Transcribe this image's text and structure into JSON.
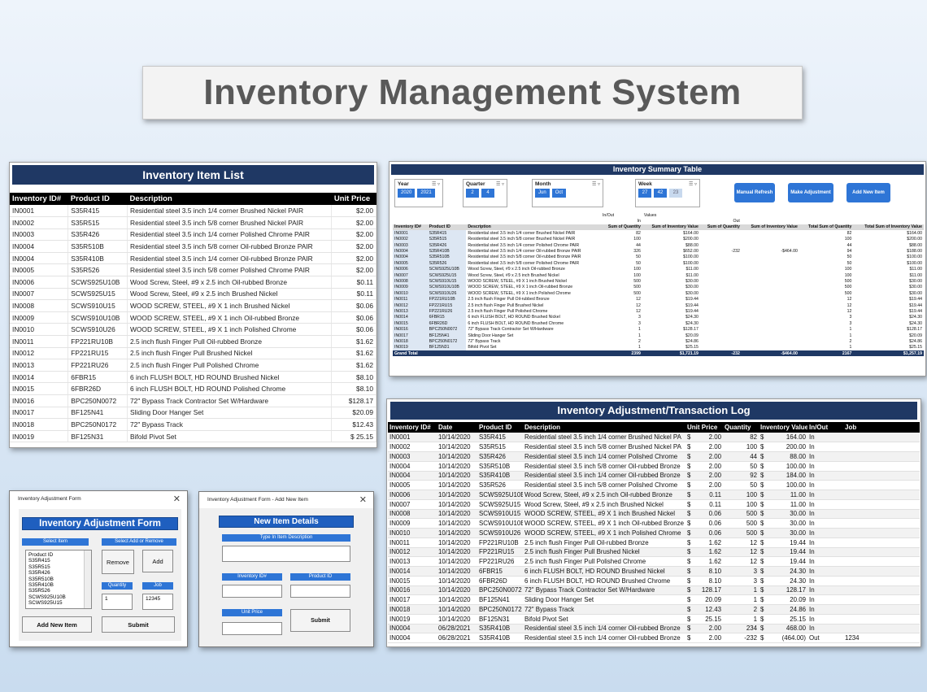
{
  "title": "Inventory Management System",
  "item_list": {
    "title": "Inventory Item List",
    "columns": [
      "Inventory ID#",
      "Product ID",
      "Description",
      "Unit Price"
    ],
    "rows": [
      [
        "IN0001",
        "S35R415",
        "Residential steel 3.5 inch 1/4 corner Brushed Nickel PAIR",
        "$2.00"
      ],
      [
        "IN0002",
        "S35R515",
        "Residential steel 3.5 inch 5/8 corner Brushed Nickel PAIR",
        "$2.00"
      ],
      [
        "IN0003",
        "S35R426",
        "Residential steel 3.5 inch 1/4 corner Polished Chrome PAIR",
        "$2.00"
      ],
      [
        "IN0004",
        "S35R510B",
        "Residential steel 3.5 inch 5/8 corner Oil-rubbed Bronze PAIR",
        "$2.00"
      ],
      [
        "IN0004",
        "S35R410B",
        "Residential steel 3.5 inch 1/4 corner Oil-rubbed Bronze PAIR",
        "$2.00"
      ],
      [
        "IN0005",
        "S35R526",
        "Residential steel 3.5 inch 5/8 corner Polished Chrome PAIR",
        "$2.00"
      ],
      [
        "IN0006",
        "SCWS925U10B",
        "Wood Screw, Steel, #9 x 2.5 inch Oil-rubbed Bronze",
        "$0.11"
      ],
      [
        "IN0007",
        "SCWS925U15",
        "Wood Screw, Steel, #9 x 2.5 inch Brushed Nickel",
        "$0.11"
      ],
      [
        "IN0008",
        "SCWS910U15",
        "WOOD SCREW, STEEL, #9 X 1 inch  Brushed Nickel",
        "$0.06"
      ],
      [
        "IN0009",
        "SCWS910U10B",
        "WOOD SCREW, STEEL, #9 X 1 inch  Oil-rubbed Bronze",
        "$0.06"
      ],
      [
        "IN0010",
        "SCWS910U26",
        "WOOD SCREW, STEEL, #9 X 1 inch  Polished Chrome",
        "$0.06"
      ],
      [
        "IN0011",
        "FP221RU10B",
        "2.5 inch flush Finger Pull  Oil-rubbed Bronze",
        "$1.62"
      ],
      [
        "IN0012",
        "FP221RU15",
        "2.5 inch flush Finger Pull  Brushed Nickel",
        "$1.62"
      ],
      [
        "IN0013",
        "FP221RU26",
        "2.5 inch flush Finger Pull  Polished Chrome",
        "$1.62"
      ],
      [
        "IN0014",
        "6FBR15",
        "6 inch FLUSH BOLT, HD ROUND Brushed Nickel",
        "$8.10"
      ],
      [
        "IN0015",
        "6FBR26D",
        "6 inch FLUSH BOLT, HD ROUND Polished Chrome",
        "$8.10"
      ],
      [
        "IN0016",
        "BPC250N0072",
        "72\" Bypass Track Contractor Set W/Hardware",
        "$128.17"
      ],
      [
        "IN0017",
        "BF125N41",
        "Sliding Door Hanger Set",
        "$20.09"
      ],
      [
        "IN0018",
        "BPC250N0172",
        "72\" Bypass Track",
        "$12.43"
      ],
      [
        "IN0019",
        "BF125N31",
        "Bifold Pivot Set",
        "$    25.15"
      ]
    ]
  },
  "summary": {
    "title": "Inventory Summary Table",
    "slicers": [
      {
        "label": "Year",
        "chips": [
          "2020",
          "2021"
        ]
      },
      {
        "label": "Quarter",
        "chips": [
          "2",
          "4"
        ]
      },
      {
        "label": "Month",
        "chips": [
          "Jun",
          "Oct"
        ]
      },
      {
        "label": "Week",
        "chips": [
          "27",
          "42",
          "23"
        ]
      }
    ],
    "buttons": [
      "Manual Refresh",
      "Make Adjustment",
      "Add New Item"
    ],
    "values_label": "Values",
    "inout_label": "In/Out",
    "in_label": "In",
    "out_label": "Out",
    "headers": [
      "Inventory ID#",
      "Product ID",
      "Description",
      "Sum of Quantity",
      "Sum of Inventory Value",
      "Sum of Quantity",
      "Sum of Inventory Value",
      "Total Sum of Quantity",
      "Total Sum of Inventory Value"
    ],
    "rows": [
      [
        "IN0001",
        "S35R415",
        "Residential steel 3.5 inch 1/4 corner Brushed Nickel PAIR",
        "82",
        "$164.00",
        "",
        "",
        "82",
        "$164.00"
      ],
      [
        "IN0002",
        "S35R515",
        "Residential steel 3.5 inch 5/8 corner Brushed Nickel PAIR",
        "100",
        "$200.00",
        "",
        "",
        "100",
        "$200.00"
      ],
      [
        "IN0003",
        "S35R426",
        "Residential steel 3.5 inch 1/4 corner Polished Chrome PAIR",
        "44",
        "$88.00",
        "",
        "",
        "44",
        "$88.00"
      ],
      [
        "IN0004",
        "S35R410B",
        "Residential steel 3.5 inch 1/4 corner Oil-rubbed Bronze PAIR",
        "326",
        "$652.00",
        "-232",
        "-$464.00",
        "94",
        "$188.00"
      ],
      [
        "IN0004",
        "S35R510B",
        "Residential steel 3.5 inch 5/8 corner Oil-rubbed Bronze PAIR",
        "50",
        "$100.00",
        "",
        "",
        "50",
        "$100.00"
      ],
      [
        "IN0005",
        "S35R526",
        "Residential steel 3.5 inch 5/8 corner Polished Chrome PAIR",
        "50",
        "$100.00",
        "",
        "",
        "50",
        "$100.00"
      ],
      [
        "IN0006",
        "SCWS925U10B",
        "Wood Screw, Steel, #9 x 2.5 inch Oil-rubbed Bronze",
        "100",
        "$11.00",
        "",
        "",
        "100",
        "$11.00"
      ],
      [
        "IN0007",
        "SCWS925U15",
        "Wood Screw, Steel, #9 x 2.5 inch Brushed Nickel",
        "100",
        "$11.00",
        "",
        "",
        "100",
        "$11.00"
      ],
      [
        "IN0008",
        "SCWS910U15",
        "WOOD SCREW, STEEL, #9 X 1 inch  Brushed Nickel",
        "500",
        "$30.00",
        "",
        "",
        "500",
        "$30.00"
      ],
      [
        "IN0009",
        "SCWS910U10B",
        "WOOD SCREW, STEEL, #9 X 1 inch  Oil-rubbed Bronze",
        "500",
        "$30.00",
        "",
        "",
        "500",
        "$30.00"
      ],
      [
        "IN0010",
        "SCWS910U26",
        "WOOD SCREW, STEEL, #9 X 1 inch  Polished Chrome",
        "500",
        "$30.00",
        "",
        "",
        "500",
        "$30.00"
      ],
      [
        "IN0011",
        "FP221RU10B",
        "2.5 inch flush Finger Pull  Oil-rubbed Bronze",
        "12",
        "$19.44",
        "",
        "",
        "12",
        "$19.44"
      ],
      [
        "IN0012",
        "FP221RU15",
        "2.5 inch flush Finger Pull  Brushed Nickel",
        "12",
        "$19.44",
        "",
        "",
        "12",
        "$19.44"
      ],
      [
        "IN0013",
        "FP221RU26",
        "2.5 inch flush Finger Pull  Polished Chrome",
        "12",
        "$19.44",
        "",
        "",
        "12",
        "$19.44"
      ],
      [
        "IN0014",
        "6FBR15",
        "6 inch FLUSH BOLT, HD ROUND Brushed Nickel",
        "3",
        "$24.30",
        "",
        "",
        "3",
        "$24.30"
      ],
      [
        "IN0015",
        "6FBR26D",
        "6 inch FLUSH BOLT, HD ROUND Brushed Chrome",
        "3",
        "$24.30",
        "",
        "",
        "3",
        "$24.30"
      ],
      [
        "IN0016",
        "BPC250N0072",
        "72\" Bypass Track Contractor Set W/Hardware",
        "1",
        "$128.17",
        "",
        "",
        "1",
        "$128.17"
      ],
      [
        "IN0017",
        "BF125N41",
        "Sliding Door Hanger Set",
        "1",
        "$20.09",
        "",
        "",
        "1",
        "$20.09"
      ],
      [
        "IN0018",
        "BPC250N0172",
        "72\" Bypass Track",
        "2",
        "$24.86",
        "",
        "",
        "2",
        "$24.86"
      ],
      [
        "IN0019",
        "BF125N31",
        "Bifold Pivot Set",
        "1",
        "$25.15",
        "",
        "",
        "1",
        "$25.15"
      ]
    ],
    "grand_total": [
      "Grand Total",
      "",
      "",
      "2399",
      "$1,721.19",
      "-232",
      "-$464.00",
      "2167",
      "$1,257.19"
    ]
  },
  "txlog": {
    "title": "Inventory Adjustment/Transaction Log",
    "columns": [
      "Inventory ID#",
      "Date",
      "Product ID",
      "Description",
      "Unit Price",
      "Quantity",
      "Inventory Value",
      "In/Out",
      "Job"
    ],
    "rows": [
      [
        "IN0001",
        "10/14/2020",
        "S35R415",
        "Residential steel 3.5 inch 1/4 corner Brushed Nickel PA",
        "$",
        "2.00",
        "82",
        "$",
        "164.00",
        "In",
        ""
      ],
      [
        "IN0002",
        "10/14/2020",
        "S35R515",
        "Residential steel 3.5 inch 5/8 corner Brushed Nickel PA",
        "$",
        "2.00",
        "100",
        "$",
        "200.00",
        "In",
        ""
      ],
      [
        "IN0003",
        "10/14/2020",
        "S35R426",
        "Residential steel 3.5 inch 1/4 corner Polished Chrome",
        "$",
        "2.00",
        "44",
        "$",
        "88.00",
        "In",
        ""
      ],
      [
        "IN0004",
        "10/14/2020",
        "S35R510B",
        "Residential steel 3.5 inch 5/8 corner Oil-rubbed Bronze",
        "$",
        "2.00",
        "50",
        "$",
        "100.00",
        "In",
        ""
      ],
      [
        "IN0004",
        "10/14/2020",
        "S35R410B",
        "Residential steel 3.5 inch 1/4 corner Oil-rubbed Bronze",
        "$",
        "2.00",
        "92",
        "$",
        "184.00",
        "In",
        ""
      ],
      [
        "IN0005",
        "10/14/2020",
        "S35R526",
        "Residential steel 3.5 inch 5/8 corner Polished Chrome",
        "$",
        "2.00",
        "50",
        "$",
        "100.00",
        "In",
        ""
      ],
      [
        "IN0006",
        "10/14/2020",
        "SCWS925U10B",
        "Wood Screw, Steel, #9 x 2.5 inch Oil-rubbed Bronze",
        "$",
        "0.11",
        "100",
        "$",
        "11.00",
        "In",
        ""
      ],
      [
        "IN0007",
        "10/14/2020",
        "SCWS925U15",
        "Wood Screw, Steel, #9 x 2.5 inch Brushed Nickel",
        "$",
        "0.11",
        "100",
        "$",
        "11.00",
        "In",
        ""
      ],
      [
        "IN0008",
        "10/14/2020",
        "SCWS910U15",
        "WOOD SCREW, STEEL, #9 X 1 inch  Brushed Nickel",
        "$",
        "0.06",
        "500",
        "$",
        "30.00",
        "In",
        ""
      ],
      [
        "IN0009",
        "10/14/2020",
        "SCWS910U10B",
        "WOOD SCREW, STEEL, #9 X 1 inch  Oil-rubbed Bronze",
        "$",
        "0.06",
        "500",
        "$",
        "30.00",
        "In",
        ""
      ],
      [
        "IN0010",
        "10/14/2020",
        "SCWS910U26",
        "WOOD SCREW, STEEL, #9 X 1 inch  Polished Chrome",
        "$",
        "0.06",
        "500",
        "$",
        "30.00",
        "In",
        ""
      ],
      [
        "IN0011",
        "10/14/2020",
        "FP221RU10B",
        "2.5 inch flush Finger Pull  Oil-rubbed Bronze",
        "$",
        "1.62",
        "12",
        "$",
        "19.44",
        "In",
        ""
      ],
      [
        "IN0012",
        "10/14/2020",
        "FP221RU15",
        "2.5 inch flush Finger Pull  Brushed Nickel",
        "$",
        "1.62",
        "12",
        "$",
        "19.44",
        "In",
        ""
      ],
      [
        "IN0013",
        "10/14/2020",
        "FP221RU26",
        "2.5 inch flush Finger Pull  Polished Chrome",
        "$",
        "1.62",
        "12",
        "$",
        "19.44",
        "In",
        ""
      ],
      [
        "IN0014",
        "10/14/2020",
        "6FBR15",
        "6 inch FLUSH BOLT, HD ROUND Brushed Nickel",
        "$",
        "8.10",
        "3",
        "$",
        "24.30",
        "In",
        ""
      ],
      [
        "IN0015",
        "10/14/2020",
        "6FBR26D",
        "6 inch FLUSH BOLT, HD ROUND Brushed Chrome",
        "$",
        "8.10",
        "3",
        "$",
        "24.30",
        "In",
        ""
      ],
      [
        "IN0016",
        "10/14/2020",
        "BPC250N0072",
        "72\" Bypass Track Contractor Set W/Hardware",
        "$",
        "128.17",
        "1",
        "$",
        "128.17",
        "In",
        ""
      ],
      [
        "IN0017",
        "10/14/2020",
        "BF125N41",
        "Sliding Door Hanger Set",
        "$",
        "20.09",
        "1",
        "$",
        "20.09",
        "In",
        ""
      ],
      [
        "IN0018",
        "10/14/2020",
        "BPC250N0172",
        "72\" Bypass Track",
        "$",
        "12.43",
        "2",
        "$",
        "24.86",
        "In",
        ""
      ],
      [
        "IN0019",
        "10/14/2020",
        "BF125N31",
        "Bifold Pivot Set",
        "$",
        "25.15",
        "1",
        "$",
        "25.15",
        "In",
        ""
      ],
      [
        "IN0004",
        "06/28/2021",
        "S35R410B",
        "Residential steel 3.5 inch 1/4 corner Oil-rubbed Bronze",
        "$",
        "2.00",
        "234",
        "$",
        "468.00",
        "In",
        ""
      ],
      [
        "IN0004",
        "06/28/2021",
        "S35R410B",
        "Residential steel 3.5 inch 1/4 corner Oil-rubbed Bronze",
        "$",
        "2.00",
        "-232",
        "$",
        "(464.00)",
        "Out",
        "1234"
      ]
    ]
  },
  "adj_form": {
    "window_title": "Inventory Adjustment Form",
    "heading": "Inventory Adjustment Form",
    "select_item_label": "Select Item",
    "select_add_remove_label": "Select Add or Remove",
    "list_items": [
      "Product ID",
      "S35R415",
      "S35R515",
      "S35R426",
      "S35R510B",
      "S35R410B",
      "S35R526",
      "SCWS925U10B",
      "SCWS925U15"
    ],
    "remove_label": "Remove",
    "add_label": "Add",
    "quantity_label": "Quantity",
    "job_label": "Job",
    "quantity_value": "1",
    "job_value": "12345",
    "add_new_item_label": "Add New Item",
    "submit_label": "Submit"
  },
  "new_form": {
    "window_title": "Inventory Adjustment Form - Add New Item",
    "heading": "New Item Details",
    "description_label": "Type In Item Description",
    "inventory_id_label": "Inventory ID#",
    "product_id_label": "Product ID",
    "unit_price_label": "Unit Price",
    "submit_label": "Submit"
  },
  "colors": {
    "navy": "#1f3864",
    "accent_blue": "#2e75d6",
    "form_title_blue": "#1f5fbf"
  }
}
